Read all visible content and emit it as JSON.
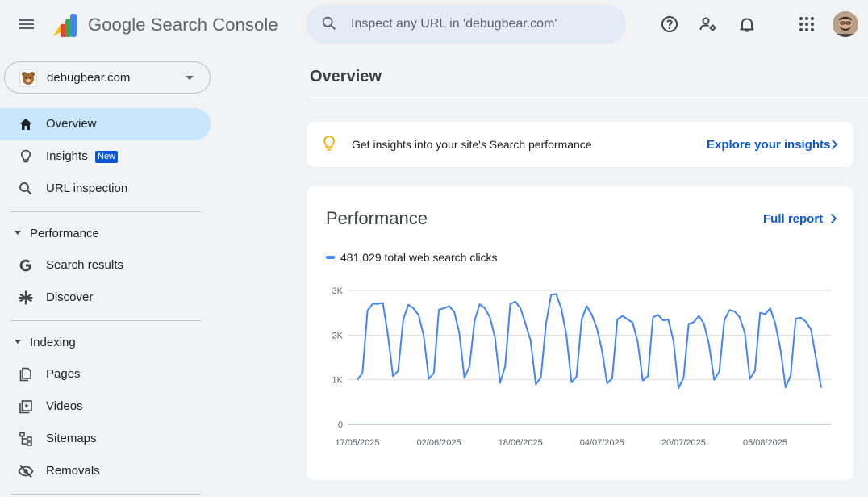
{
  "app": {
    "brand": "Google Search Console"
  },
  "search": {
    "placeholder": "Inspect any URL in 'debugbear.com'",
    "value": ""
  },
  "header_icons": [
    "help-icon",
    "manage-users-icon",
    "notifications-icon",
    "apps-grid-icon"
  ],
  "property": {
    "name": "debugbear.com"
  },
  "sidebar": {
    "items": [
      {
        "label": "Overview",
        "icon": "home-icon",
        "active": true
      },
      {
        "label": "Insights",
        "icon": "lightbulb-icon",
        "badge": "New"
      },
      {
        "label": "URL inspection",
        "icon": "search-icon"
      }
    ],
    "performance": {
      "label": "Performance",
      "items": [
        {
          "label": "Search results",
          "icon": "google-g-icon"
        },
        {
          "label": "Discover",
          "icon": "asterisk-icon"
        }
      ]
    },
    "indexing": {
      "label": "Indexing",
      "items": [
        {
          "label": "Pages",
          "icon": "pages-icon"
        },
        {
          "label": "Videos",
          "icon": "videos-icon"
        },
        {
          "label": "Sitemaps",
          "icon": "sitemaps-icon"
        },
        {
          "label": "Removals",
          "icon": "removals-icon"
        }
      ]
    }
  },
  "main": {
    "title": "Overview",
    "insight": {
      "text": "Get insights into your site's Search performance",
      "link": "Explore your insights"
    },
    "performance": {
      "title": "Performance",
      "link": "Full report",
      "legend": "481,029 total web search clicks"
    }
  },
  "colors": {
    "accent": "#0b57d0",
    "series": "#4285f4",
    "active_nav": "#c8e6fc"
  },
  "chart_data": {
    "type": "line",
    "ylim": [
      0,
      3000
    ],
    "y_ticks": [
      "0",
      "1K",
      "2K",
      "3K"
    ],
    "x_ticks": [
      "17/05/2025",
      "02/06/2025",
      "18/06/2025",
      "04/07/2025",
      "20/07/2025",
      "05/08/2025"
    ],
    "series": [
      {
        "name": "481,029 total web search clicks",
        "x_start": "2025-05-17",
        "values": [
          1000,
          1150,
          2550,
          2700,
          2700,
          2720,
          2000,
          1080,
          1200,
          2350,
          2680,
          2600,
          2450,
          2000,
          1020,
          1150,
          2570,
          2600,
          2650,
          2520,
          2050,
          1040,
          1300,
          2320,
          2690,
          2600,
          2400,
          1950,
          930,
          1300,
          2700,
          2750,
          2600,
          2250,
          1870,
          900,
          1050,
          2250,
          2900,
          2920,
          2600,
          2000,
          940,
          1070,
          2350,
          2650,
          2450,
          2150,
          1650,
          920,
          1030,
          2350,
          2430,
          2350,
          2280,
          1850,
          980,
          1080,
          2400,
          2450,
          2330,
          2350,
          1880,
          810,
          1050,
          2250,
          2290,
          2430,
          2250,
          1780,
          1000,
          1180,
          2330,
          2560,
          2530,
          2400,
          2060,
          1020,
          1200,
          2500,
          2470,
          2600,
          2250,
          1680,
          830,
          1090,
          2370,
          2390,
          2300,
          2120,
          1460,
          820
        ]
      }
    ]
  }
}
